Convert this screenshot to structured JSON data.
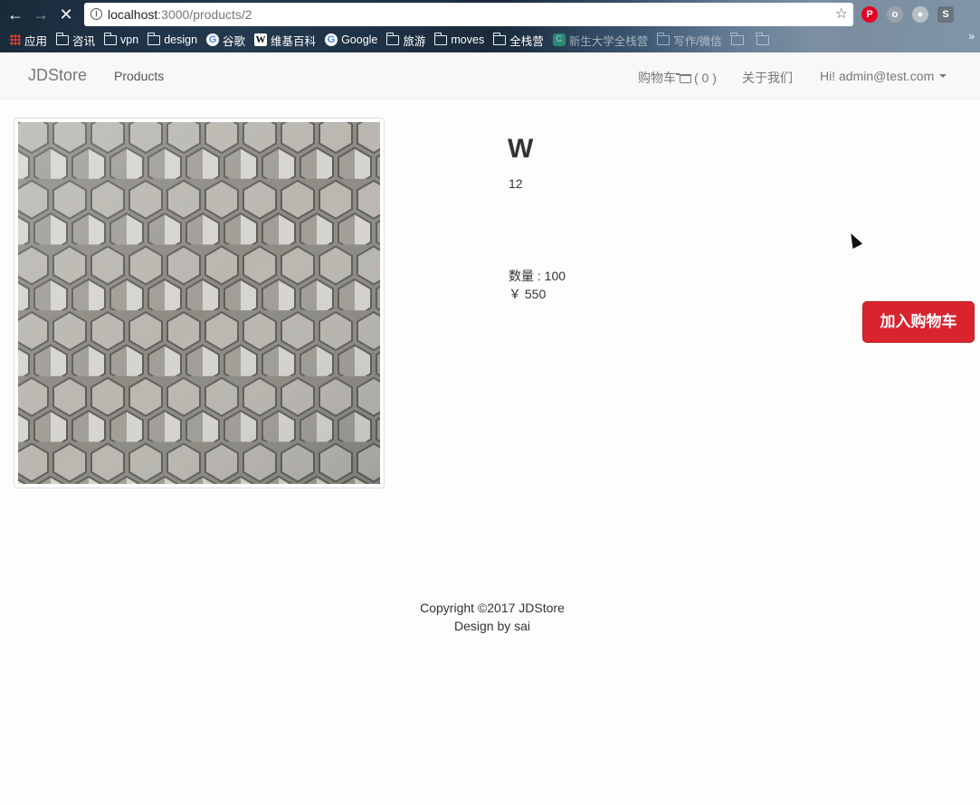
{
  "browser": {
    "url_host": "localhost",
    "url_rest": ":3000/products/2",
    "bookmarks": [
      {
        "label": "应用",
        "icon": "apps-icon"
      },
      {
        "label": "咨讯",
        "icon": "folder-icon"
      },
      {
        "label": "vpn",
        "icon": "folder-icon"
      },
      {
        "label": "design",
        "icon": "folder-icon"
      },
      {
        "label": "谷歌",
        "icon": "google-icon"
      },
      {
        "label": "维基百科",
        "icon": "wikipedia-icon"
      },
      {
        "label": "Google",
        "icon": "google-icon"
      },
      {
        "label": "旅游",
        "icon": "folder-icon"
      },
      {
        "label": "moves",
        "icon": "folder-icon"
      },
      {
        "label": "全栈营",
        "icon": "folder-icon"
      },
      {
        "label": "新生大学全栈营",
        "icon": "site-icon"
      },
      {
        "label": "写作/微信",
        "icon": "folder-icon"
      }
    ],
    "extensions": [
      "pinterest-icon",
      "extension-icon",
      "extension-icon-2",
      "s-extension-icon"
    ]
  },
  "navbar": {
    "brand": "JDStore",
    "products": "Products",
    "cart_label": "购物车",
    "cart_count": "( 0 )",
    "about": "关于我们",
    "user": "Hi! admin@test.com"
  },
  "product": {
    "title": "W",
    "description": "12",
    "quantity": "数量 : 100",
    "price": "￥ 550",
    "add_to_cart": "加入购物车"
  },
  "footer": {
    "copyright": "Copyright ©2017 JDStore",
    "design": "Design by sai"
  },
  "colors": {
    "accent": "#d9232d",
    "navbar_bg": "#f8f8f8"
  }
}
